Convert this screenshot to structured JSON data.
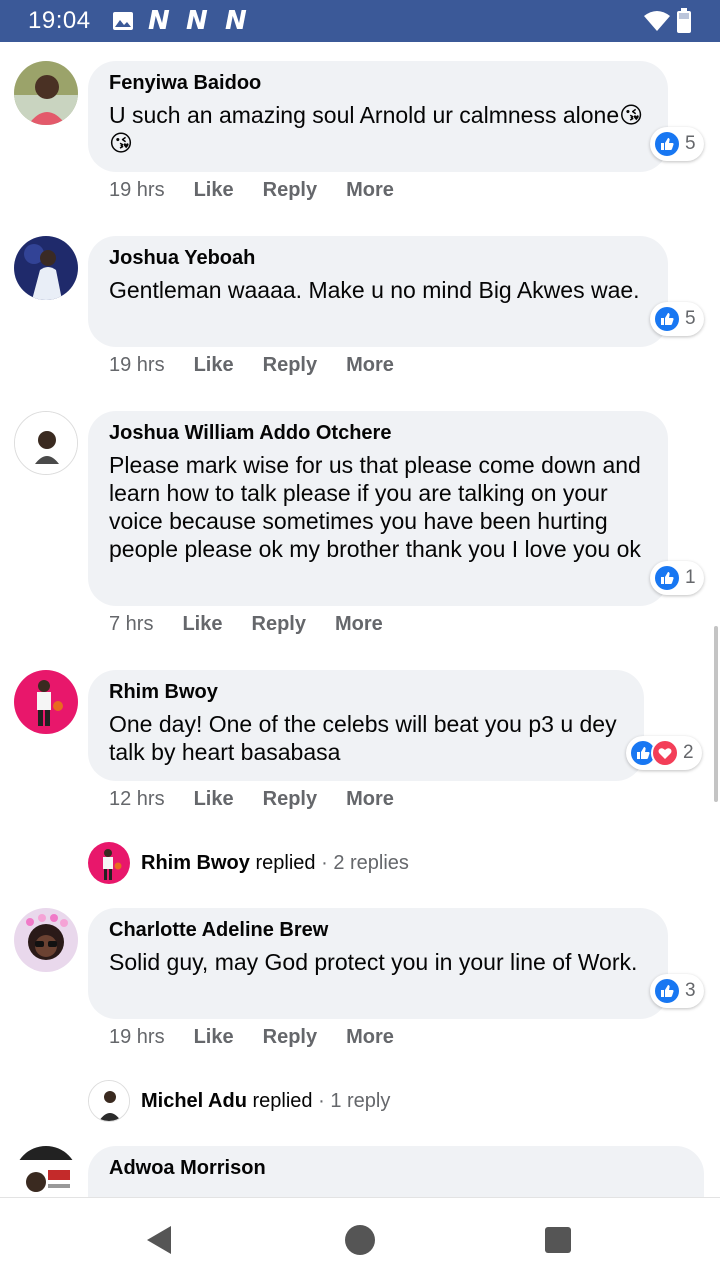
{
  "status_bar": {
    "time": "19:04",
    "notif_letters": [
      "N",
      "N",
      "N"
    ],
    "icons": [
      "gallery-icon",
      "wifi-icon",
      "battery-icon"
    ]
  },
  "comments": [
    {
      "name": "Fenyiwa Baidoo",
      "text": "U such an amazing soul Arnold ur calmness alone😘😘",
      "reaction_count": "5",
      "reactions": [
        "like"
      ],
      "time": "19 hrs",
      "actions": [
        "Like",
        "Reply",
        "More"
      ]
    },
    {
      "name": "Joshua Yeboah",
      "text": "Gentleman waaaa. Make u no mind Big Akwes wae.",
      "reaction_count": "5",
      "reactions": [
        "like"
      ],
      "time": "19 hrs",
      "actions": [
        "Like",
        "Reply",
        "More"
      ]
    },
    {
      "name": "Joshua William Addo Otchere",
      "text": "Please mark wise for us that please come down and learn how to talk please if you are talking on your voice because sometimes you have been hurting people please ok my brother thank you I love you ok",
      "reaction_count": "1",
      "reactions": [
        "like"
      ],
      "time": "7 hrs",
      "actions": [
        "Like",
        "Reply",
        "More"
      ]
    },
    {
      "name": "Rhim Bwoy",
      "text": "One day! One of the celebs will beat you p3 u dey talk by heart basabasa",
      "reaction_count": "2",
      "reactions": [
        "like",
        "love"
      ],
      "time": "12 hrs",
      "actions": [
        "Like",
        "Reply",
        "More"
      ],
      "replies": {
        "name": "Rhim Bwoy",
        "verb": "replied",
        "count": "2 replies"
      }
    },
    {
      "name": "Charlotte Adeline Brew",
      "text": "Solid guy, may God protect you in your line of Work.",
      "reaction_count": "3",
      "reactions": [
        "like"
      ],
      "time": "19 hrs",
      "actions": [
        "Like",
        "Reply",
        "More"
      ],
      "replies": {
        "name": "Michel Adu",
        "verb": "replied",
        "count": "1 reply"
      }
    },
    {
      "name": "Adwoa Morrison",
      "text": "",
      "time": "",
      "actions": []
    }
  ],
  "separator": "·",
  "nav": {
    "back": "back-icon",
    "home": "home-icon",
    "recents": "recents-icon"
  },
  "colors": {
    "status_bar": "#3b5998",
    "bubble": "#f0f2f5",
    "like": "#1877f2",
    "love": "#f33e58",
    "meta": "#65676b"
  }
}
